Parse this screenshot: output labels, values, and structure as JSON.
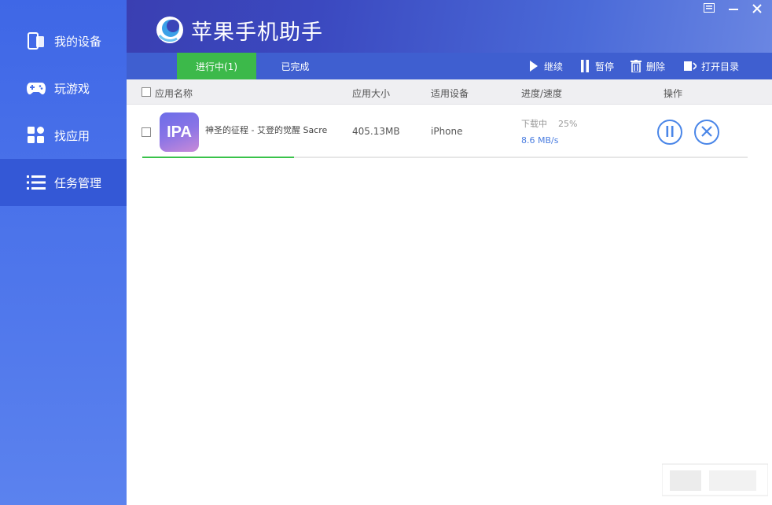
{
  "app": {
    "title": "苹果手机助手"
  },
  "sidebar": {
    "items": [
      {
        "label": "我的设备",
        "icon": "phone-icon"
      },
      {
        "label": "玩游戏",
        "icon": "gamepad-icon"
      },
      {
        "label": "找应用",
        "icon": "grid-icon"
      },
      {
        "label": "任务管理",
        "icon": "list-icon",
        "active": true
      }
    ]
  },
  "window_controls": [
    "minimize-icon",
    "close-icon"
  ],
  "tabs": [
    {
      "label": "进行中(1)",
      "active": true
    },
    {
      "label": "已完成",
      "active": false
    }
  ],
  "toolbar": {
    "resume_label": "继续",
    "pause_label": "暂停",
    "delete_label": "删除",
    "open_dir_label": "打开目录"
  },
  "table": {
    "columns": {
      "name": "应用名称",
      "size": "应用大小",
      "device": "适用设备",
      "progress": "进度/速度",
      "actions": "操作"
    },
    "rows": [
      {
        "icon_text": "IPA",
        "name": "神圣的征程 - 艾登的觉醒 Sacre",
        "size": "405.13MB",
        "device": "iPhone",
        "status": "下载中",
        "percent": "25%",
        "progress": 0.25,
        "speed": "8.6 MB/s"
      }
    ]
  },
  "colors": {
    "sidebar": "#4a72ea",
    "header": "#3b49c0",
    "active_tab": "#3cb94a",
    "progress": "#39c24a",
    "action": "#4a86e8",
    "speed": "#4a7de0"
  }
}
